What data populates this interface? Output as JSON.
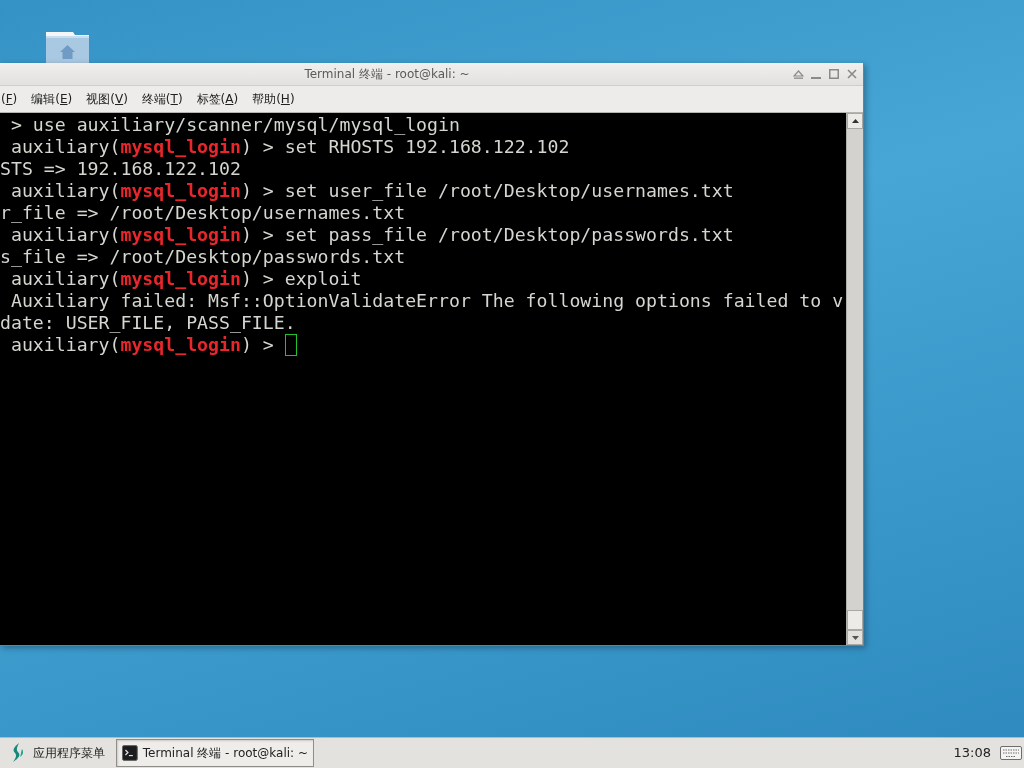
{
  "window": {
    "title": "Terminal 终端 - root@kali: ~",
    "menu": [
      {
        "text": "(",
        "accel": "F",
        "tail": ")"
      },
      {
        "text": "编辑(",
        "accel": "E",
        "tail": ")"
      },
      {
        "text": "视图(",
        "accel": "V",
        "tail": ")"
      },
      {
        "text": "终端(",
        "accel": "T",
        "tail": ")"
      },
      {
        "text": "标签(",
        "accel": "A",
        "tail": ")"
      },
      {
        "text": "帮助(",
        "accel": "H",
        "tail": ")"
      }
    ]
  },
  "terminal": {
    "lines": [
      {
        "cursor": false,
        "segments": [
          {
            "kind": "text",
            "text": " > use auxiliary/scanner/mysql/mysql_login"
          }
        ]
      },
      {
        "cursor": false,
        "segments": [
          {
            "kind": "text",
            "text": " auxiliary("
          },
          {
            "kind": "module",
            "text": "mysql_login"
          },
          {
            "kind": "text",
            "text": ") > set RHOSTS 192.168.122.102"
          }
        ]
      },
      {
        "cursor": false,
        "segments": [
          {
            "kind": "text",
            "text": "STS => 192.168.122.102"
          }
        ]
      },
      {
        "cursor": false,
        "segments": [
          {
            "kind": "text",
            "text": " auxiliary("
          },
          {
            "kind": "module",
            "text": "mysql_login"
          },
          {
            "kind": "text",
            "text": ") > set user_file /root/Desktop/usernames.txt"
          }
        ]
      },
      {
        "cursor": false,
        "segments": [
          {
            "kind": "text",
            "text": "r_file => /root/Desktop/usernames.txt"
          }
        ]
      },
      {
        "cursor": false,
        "segments": [
          {
            "kind": "text",
            "text": " auxiliary("
          },
          {
            "kind": "module",
            "text": "mysql_login"
          },
          {
            "kind": "text",
            "text": ") > set pass_file /root/Desktop/passwords.txt"
          }
        ]
      },
      {
        "cursor": false,
        "segments": [
          {
            "kind": "text",
            "text": "s_file => /root/Desktop/passwords.txt"
          }
        ]
      },
      {
        "cursor": false,
        "segments": [
          {
            "kind": "text",
            "text": " auxiliary("
          },
          {
            "kind": "module",
            "text": "mysql_login"
          },
          {
            "kind": "text",
            "text": ") > exploit"
          }
        ]
      },
      {
        "cursor": false,
        "segments": [
          {
            "kind": "text",
            "text": " Auxiliary failed: Msf::OptionValidateError The following options failed to v"
          }
        ]
      },
      {
        "cursor": false,
        "segments": [
          {
            "kind": "text",
            "text": "date: USER_FILE, PASS_FILE."
          }
        ]
      },
      {
        "cursor": true,
        "segments": [
          {
            "kind": "text",
            "text": " auxiliary("
          },
          {
            "kind": "module",
            "text": "mysql_login"
          },
          {
            "kind": "text",
            "text": ") > "
          }
        ]
      }
    ]
  },
  "taskbar": {
    "menu_label": "应用程序菜单",
    "tasks": [
      {
        "title": "Terminal 终端 - root@kali: ~",
        "selected": true
      }
    ],
    "clock": "13:08"
  }
}
